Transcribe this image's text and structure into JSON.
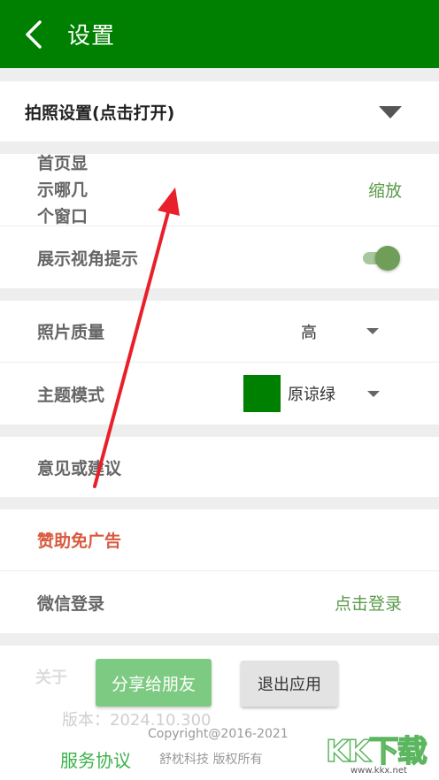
{
  "appbar": {
    "title": "设置"
  },
  "camera": {
    "label": "拍照设置(点击打开)"
  },
  "first_window": {
    "label_lines": [
      "首页显",
      "示哪几",
      "个窗口"
    ],
    "value": "缩放"
  },
  "angle_hint": {
    "label": "展示视角提示",
    "enabled": true
  },
  "photo_quality": {
    "label": "照片质量",
    "value": "高"
  },
  "theme": {
    "label": "主题模式",
    "value": "原谅绿",
    "swatch_color": "#008000"
  },
  "feedback": {
    "label": "意见或建议"
  },
  "sponsor": {
    "label": "赞助免广告"
  },
  "wechat": {
    "label": "微信登录",
    "action": "点击登录"
  },
  "about": {
    "label": "关于",
    "share_button": "分享给朋友",
    "exit_button": "退出应用",
    "version": "版本：2024.10.300",
    "copyright": "Copyright@2016-2021",
    "company": "舒枕科技 版权所有",
    "service_link": "服务协议",
    "watermark": "KK下载",
    "watermark_url": "www.kkx.net"
  },
  "colors": {
    "primary": "#008000",
    "link": "#5a9a4a",
    "sponsor": "#d9593f",
    "annotation": "#e8202a"
  }
}
